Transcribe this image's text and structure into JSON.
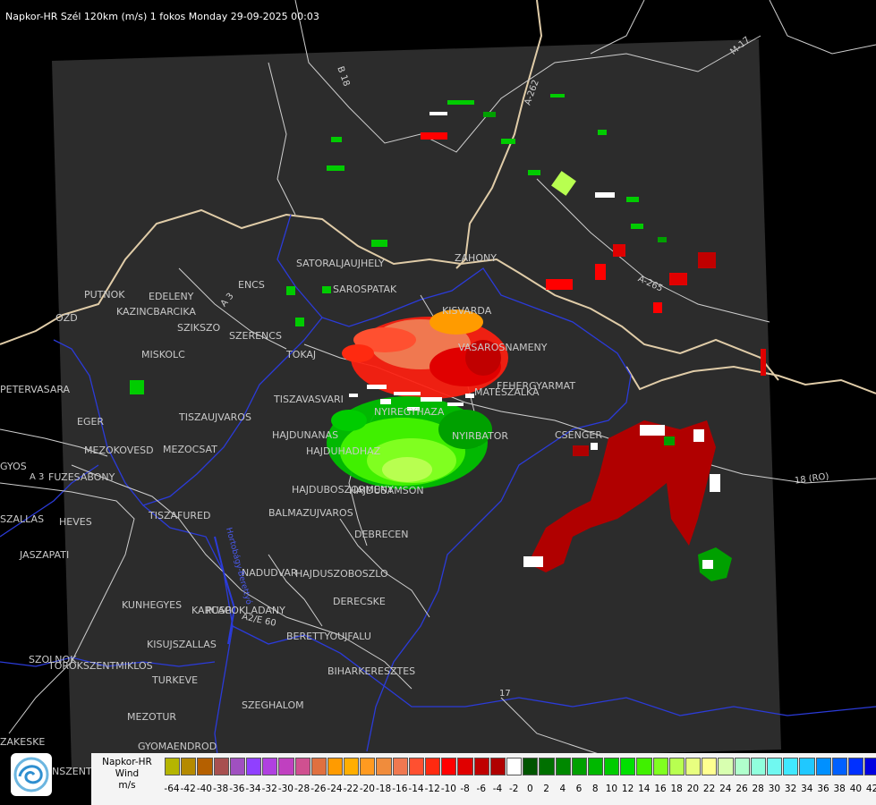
{
  "header": {
    "title": "Napkor-HR Szél 120km (m/s) 1 fokos Monday 29-09-2025 00:03"
  },
  "map": {
    "places": [
      "SATORALJAUJHELY",
      "SAROSPATAK",
      "ZAHONY",
      "KISVARDA",
      "VASAROSNAMENY",
      "FEHERGYARMAT",
      "MATESZALKA",
      "CSENGER",
      "NYIRBATOR",
      "NYIREGYHAZA",
      "TISZAVASVARI",
      "HAJDUNANAS",
      "HAJDUHADHAZ",
      "HAJDUBOSZORMENY",
      "HAJDUSAMSON",
      "BALMAZUJVAROS",
      "DEBRECEN",
      "NADUDVAR",
      "HAJDUSZOBOSZLO",
      "DERECSKE",
      "BERETTYOUJFALU",
      "BIHARKERESZTES",
      "SZEGHALOM",
      "KUNHEGYES",
      "KISUJSZALLAS",
      "KARCAG",
      "PUSPOKLADANY",
      "TURKEVE",
      "TISZAFURED",
      "HEVES",
      "JASZAPATI",
      "FUZESABONY",
      "MEZOKOVESD",
      "MEZOCSAT",
      "TISZAUJVAROS",
      "EGER",
      "PETERVASARA",
      "PUTNOK",
      "KAZINCBARCIKA",
      "EDELENY",
      "SZIKSZO",
      "SZERENCS",
      "TOKAJ",
      "MISKOLC",
      "OZD",
      "GYOMAENDROD",
      "MEZOTUR",
      "SZOLNOK",
      "TOROKSZENTMIKLOS",
      "GYOS",
      "SZALLAS",
      "ZAKESKE",
      "NSZENTM",
      "ENCS"
    ],
    "roads": [
      "B 18",
      "A-262",
      "M-17",
      "A-265",
      "18 (RO)",
      "17",
      "A 3",
      "A 3",
      "A2/E 60"
    ],
    "river_label": "Hortobágy-Berettyó"
  },
  "legend": {
    "name_line1": "Napkor-HR",
    "name_line2": "Wind",
    "unit": "m/s",
    "colors": [
      "#b5b500",
      "#b58a00",
      "#b56000",
      "#a85050",
      "#a050c0",
      "#9040ff",
      "#b040e0",
      "#c040c0",
      "#d05090",
      "#e07040",
      "#ff9b00",
      "#ffae00",
      "#ff9a20",
      "#f08c3c",
      "#f07850",
      "#ff5030",
      "#ff2a10",
      "#ff0000",
      "#e00000",
      "#c00000",
      "#b00000",
      "#ffffff",
      "#005500",
      "#007000",
      "#008800",
      "#00a000",
      "#00b800",
      "#00cc00",
      "#00e000",
      "#40f000",
      "#80ff20",
      "#b8ff50",
      "#e8ff80",
      "#ffff90",
      "#d8ffb0",
      "#b0ffcc",
      "#90ffdd",
      "#70f8f0",
      "#40e8ff",
      "#20c8ff",
      "#0090ff",
      "#0060ff",
      "#0030ff",
      "#0000e0"
    ],
    "ticks": [
      "-64",
      "-42",
      "-40",
      "-38",
      "-36",
      "-34",
      "-32",
      "-30",
      "-28",
      "-26",
      "-24",
      "-22",
      "-20",
      "-18",
      "-16",
      "-14",
      "-12",
      "-10",
      "-8",
      "-6",
      "-4",
      "-2",
      "0",
      "2",
      "4",
      "6",
      "8",
      "10",
      "12",
      "14",
      "16",
      "18",
      "20",
      "22",
      "24",
      "26",
      "28",
      "30",
      "32",
      "34",
      "36",
      "38",
      "40",
      "42"
    ]
  }
}
